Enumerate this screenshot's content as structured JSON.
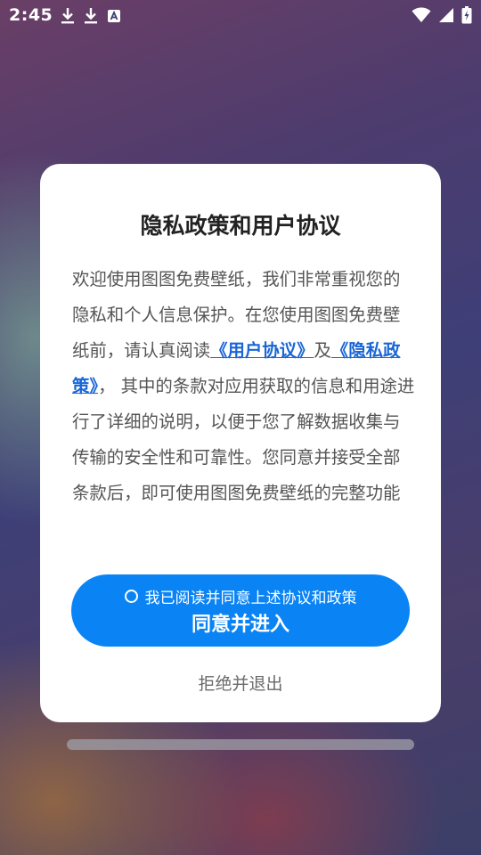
{
  "status_bar": {
    "time": "2:45",
    "icons": [
      "download-icon",
      "download-icon",
      "text-notification-icon",
      "wifi-icon",
      "cell-signal-icon",
      "battery-charging-icon"
    ]
  },
  "dialog": {
    "title": "隐私政策和用户协议",
    "body": {
      "text_1": "欢迎使用图图免费壁纸，我们非常重视您的隐私和个人信息保护。在您使用图图免费壁纸前，请认真阅读",
      "link_user_agreement": "《用户协议》",
      "text_2": "及",
      "link_privacy_policy": "《隐私政策》",
      "text_3": "， 其中的条款对应用获取的信息和用途进行了详细的说明，以便于您了解数据收集与传输的安全性和可靠性。您同意并接受全部条款后，即可使用图图免费壁纸的完整功能"
    },
    "agree_button": {
      "checkbox_label": "我已阅读并同意上述协议和政策",
      "label": "同意并进入"
    },
    "reject_button": {
      "label": "拒绝并退出"
    }
  },
  "colors": {
    "primary": "#0a84f5",
    "link": "#1a66d6",
    "dialog_bg": "#ffffff"
  }
}
